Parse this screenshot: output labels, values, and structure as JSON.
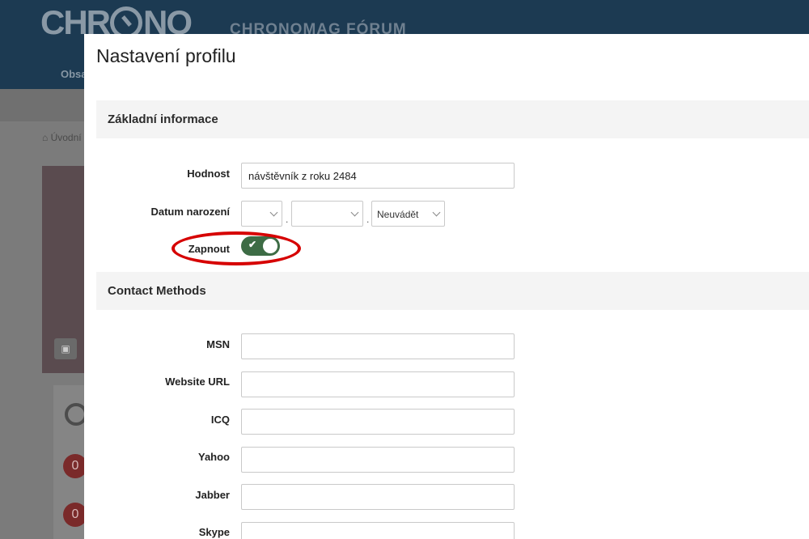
{
  "background": {
    "logo_text_left": "CHR",
    "logo_text_right": "NO",
    "forum_title": "CHRONOMAG FÓRUM",
    "nav_item": "Obsa",
    "breadcrumb": "Úvodní",
    "badge_1": "0",
    "badge_2": "0"
  },
  "modal": {
    "title": "Nastavení profilu",
    "section_basic": "Základní informace",
    "fields": {
      "rank_label": "Hodnost",
      "rank_value": "návštěvník z roku 2484",
      "birthday_label": "Datum narození",
      "birthday_day": "",
      "birthday_month": "",
      "birthday_year": "Neuvádět",
      "enable_label": "Zapnout"
    },
    "section_contact": "Contact Methods",
    "contacts": {
      "msn": "MSN",
      "website": "Website URL",
      "icq": "ICQ",
      "yahoo": "Yahoo",
      "jabber": "Jabber",
      "skype": "Skype"
    },
    "toggle_on": true,
    "toggle_color": "#3d6c45",
    "highlight_color": "#d60000"
  }
}
